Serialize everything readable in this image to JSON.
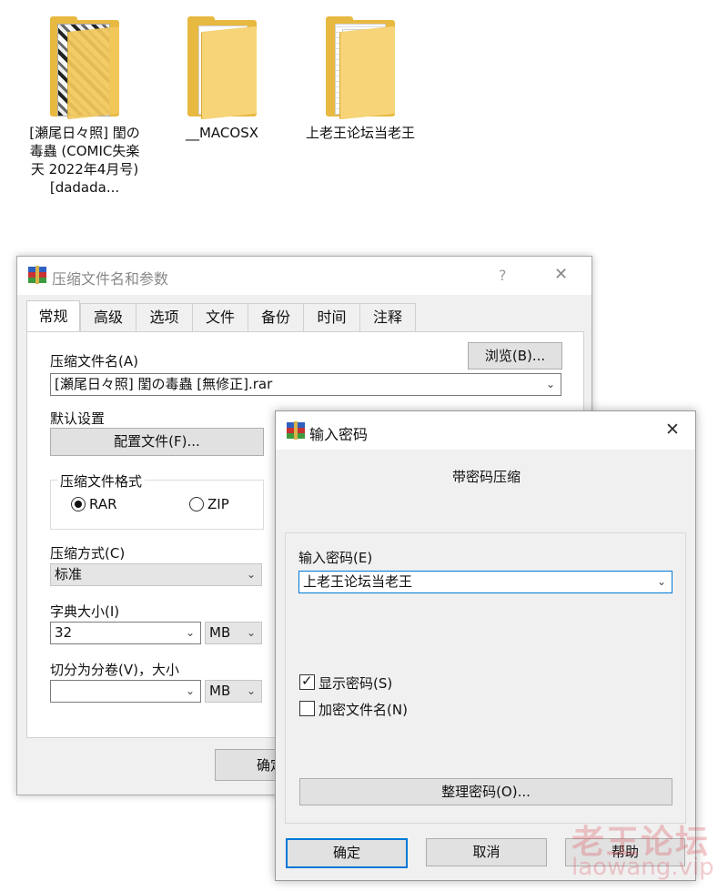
{
  "desktop": {
    "folders": [
      {
        "label": "[瀬尾日々照] 閨の毒蟲 (COMIC失楽天 2022年4月号) [dadada..."
      },
      {
        "label": "__MACOSX"
      },
      {
        "label": "上老王论坛当老王"
      }
    ]
  },
  "archive_dialog": {
    "title": "压缩文件名和参数",
    "help": "?",
    "close": "✕",
    "tabs": [
      "常规",
      "高级",
      "选项",
      "文件",
      "备份",
      "时间",
      "注释"
    ],
    "archive_name_label": "压缩文件名(A)",
    "browse_button": "浏览(B)...",
    "archive_name_value": "[瀬尾日々照] 閨の毒蟲  [無修正].rar",
    "default_settings_label": "默认设置",
    "profiles_button": "配置文件(F)...",
    "format_group_label": "压缩文件格式",
    "format_rar": "RAR",
    "format_zip": "ZIP",
    "method_label": "压缩方式(C)",
    "method_value": "标准",
    "dict_label": "字典大小(I)",
    "dict_value": "32",
    "dict_unit": "MB",
    "split_label": "切分为分卷(V)，大小",
    "split_value": "",
    "split_unit": "MB",
    "ok_button_partial": "确定"
  },
  "password_dialog": {
    "title": "输入密码",
    "close": "✕",
    "subtitle": "带密码压缩",
    "password_label": "输入密码(E)",
    "password_value": "上老王论坛当老王",
    "show_password_label": "显示密码(S)",
    "encrypt_names_label": "加密文件名(N)",
    "organize_button": "整理密码(O)...",
    "ok_button": "确定",
    "cancel_button": "取消",
    "help_button": "帮助"
  },
  "watermark": {
    "text_cn": "老王论坛",
    "text_url": "laowang.vip"
  }
}
